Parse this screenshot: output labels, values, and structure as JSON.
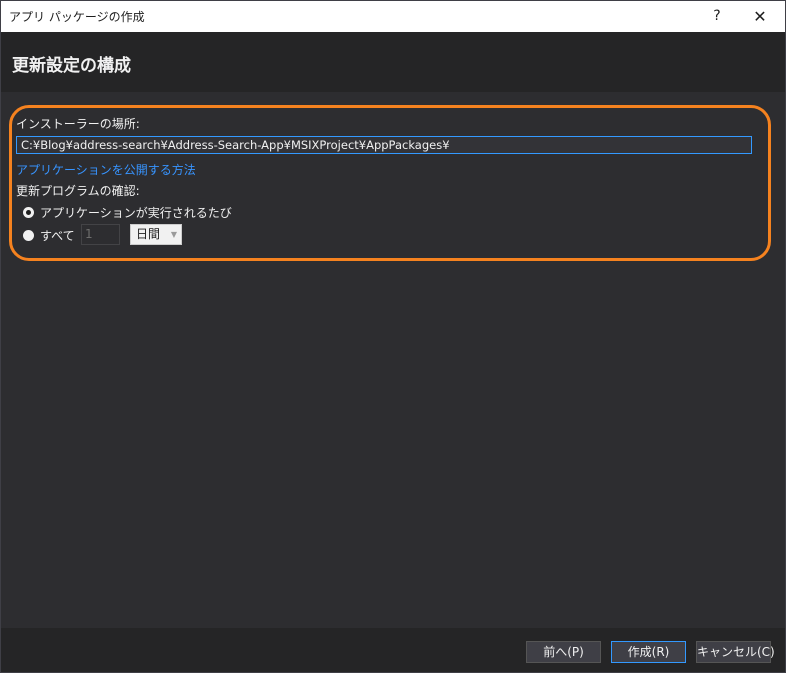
{
  "window": {
    "title": "アプリ パッケージの作成",
    "help_label": "?",
    "close_label": "✕"
  },
  "header": {
    "title": "更新設定の構成"
  },
  "form": {
    "install_location_label": "インストーラーの場所:",
    "install_location_value": "C:¥Blog¥address-search¥Address-Search-App¥MSIXProject¥AppPackages¥",
    "publish_link": "アプリケーションを公開する方法",
    "update_check_label": "更新プログラムの確認:",
    "options": [
      {
        "label": "アプリケーションが実行されるたび",
        "selected": true
      },
      {
        "label": "すべて",
        "selected": false
      }
    ],
    "interval_value": "1",
    "interval_unit": "日間"
  },
  "footer": {
    "prev_label": "前へ(P)",
    "create_label": "作成(R)",
    "cancel_label": "キャンセル(C)"
  },
  "colors": {
    "highlight": "#f5821f",
    "link": "#3794ff",
    "accent": "#3399ff"
  },
  "icons": {
    "close": "close-icon",
    "chevron": "chevron-down-icon"
  }
}
